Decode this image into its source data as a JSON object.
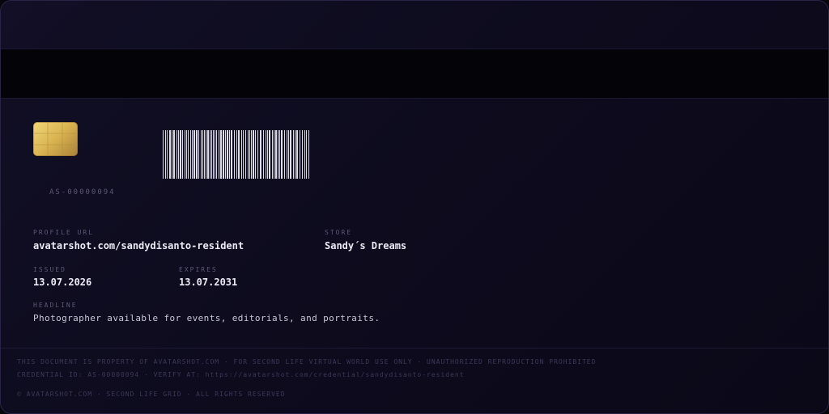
{
  "card": {
    "serial": "AS-00000094",
    "fields": {
      "profile_url_label": "PROFILE URL",
      "profile_url_value": "avatarshot.com/sandydisanto-resident",
      "store_label": "STORE",
      "store_value": "Sandy´s Dreams",
      "issued_label": "ISSUED",
      "issued_value": "13.07.2026",
      "expires_label": "EXPIRES",
      "expires_value": "13.07.2031",
      "headline_label": "HEADLINE",
      "headline_value": "Photographer available for events, editorials, and portraits."
    },
    "footer": {
      "line1": "THIS DOCUMENT IS PROPERTY OF AVATARSHOT.COM · FOR SECOND LIFE VIRTUAL WORLD USE ONLY · UNAUTHORIZED REPRODUCTION PROHIBITED",
      "line2": "CREDENTIAL ID: AS-00000094 · VERIFY AT: https://avatarshot.com/credential/sandydisanto-resident",
      "line3": "© AVATARSHOT.COM · SECOND LIFE GRID · ALL RIGHTS RESERVED"
    }
  },
  "icons": {
    "chip": "smart-chip-icon",
    "barcode": "barcode-icon"
  },
  "colors": {
    "background": "#0d0b1d",
    "stripe": "#040307",
    "chip_gold": "#d9b350",
    "text_primary": "#ecebf5",
    "text_muted": "#5c5878"
  }
}
